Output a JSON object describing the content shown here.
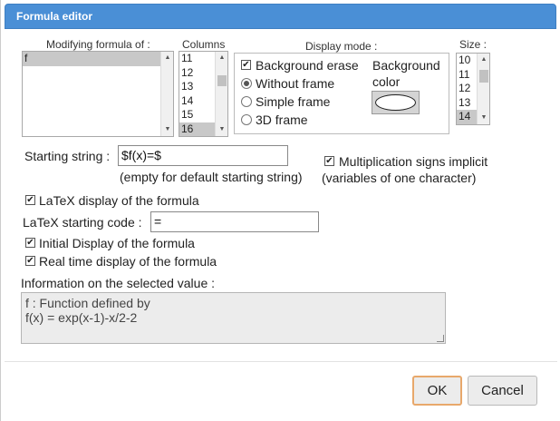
{
  "dialog": {
    "title": "Formula editor"
  },
  "formula_list": {
    "label": "Modifying formula of :",
    "items": [
      "f"
    ],
    "selected": "f"
  },
  "columns": {
    "label": "Columns",
    "items": [
      "11",
      "12",
      "13",
      "14",
      "15",
      "16"
    ],
    "selected": "16"
  },
  "display_mode": {
    "label": "Display mode :",
    "background_erase": {
      "label": "Background erase",
      "checked": true
    },
    "options": [
      {
        "label": "Without frame",
        "selected": true
      },
      {
        "label": "Simple frame",
        "selected": false
      },
      {
        "label": "3D frame",
        "selected": false
      }
    ],
    "background_color_label_1": "Background",
    "background_color_label_2": "color",
    "background_color_value": "#ffffff"
  },
  "size": {
    "label": "Size :",
    "items": [
      "10",
      "11",
      "12",
      "13",
      "14"
    ],
    "selected": "14"
  },
  "starting_string": {
    "label": "Starting string :",
    "value": "$f(x)=$",
    "hint": "(empty for default starting string)"
  },
  "multiplication": {
    "label_1": "Multiplication signs implicit",
    "label_2": "(variables of one character)",
    "checked": true
  },
  "latex_display": {
    "label": "LaTeX display of the formula",
    "checked": true
  },
  "latex_code": {
    "label": "LaTeX starting code :",
    "value": "="
  },
  "initial_display": {
    "label": "Initial Display of the formula",
    "checked": true
  },
  "realtime_display": {
    "label": "Real time display of the formula",
    "checked": true
  },
  "info": {
    "label": "Information on the selected value :",
    "line_1": "f : Function defined by",
    "line_2": "f(x) = exp(x-1)-x/2-2"
  },
  "buttons": {
    "ok": "OK",
    "cancel": "Cancel"
  },
  "icons": {
    "check": "✔",
    "up": "▲",
    "down": "▼"
  },
  "colors": {
    "titlebar": "#4a8fd6",
    "ok_border": "#e8a86b",
    "selection": "#c8c8c8"
  }
}
